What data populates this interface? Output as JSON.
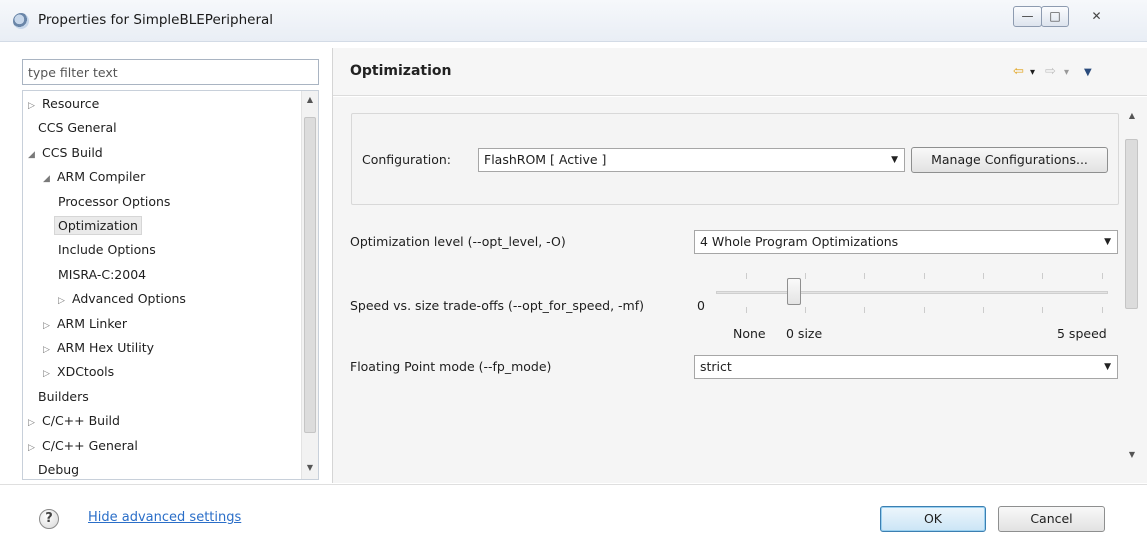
{
  "window": {
    "title": "Properties for SimpleBLEPeripheral",
    "minimize_glyph": "—",
    "maximize_glyph": "□",
    "close_glyph": "✕"
  },
  "filter": {
    "placeholder": "type filter text"
  },
  "tree": {
    "items": [
      {
        "label": "Resource",
        "arrow": "▷"
      },
      {
        "label": "CCS General",
        "arrow": ""
      },
      {
        "label": "CCS Build",
        "arrow": "◢"
      },
      {
        "label": "ARM Compiler",
        "arrow": "◢"
      },
      {
        "label": "Processor Options",
        "arrow": ""
      },
      {
        "label": "Optimization",
        "arrow": ""
      },
      {
        "label": "Include Options",
        "arrow": ""
      },
      {
        "label": "MISRA-C:2004",
        "arrow": ""
      },
      {
        "label": "Advanced Options",
        "arrow": "▷"
      },
      {
        "label": "ARM Linker",
        "arrow": "▷"
      },
      {
        "label": "ARM Hex Utility",
        "arrow": "▷"
      },
      {
        "label": "XDCtools",
        "arrow": "▷"
      },
      {
        "label": "Builders",
        "arrow": ""
      },
      {
        "label": "C/C++ Build",
        "arrow": "▷"
      },
      {
        "label": "C/C++ General",
        "arrow": "▷"
      },
      {
        "label": "Debug",
        "arrow": ""
      }
    ],
    "selected": "Optimization"
  },
  "page": {
    "title": "Optimization",
    "nav_back": "⇦",
    "nav_back_menu": "▾",
    "nav_forward": "⇨",
    "nav_forward_menu": "▾",
    "view_menu": "▼"
  },
  "config": {
    "label": "Configuration:",
    "value": "FlashROM  [ Active ]",
    "manage_button": "Manage Configurations..."
  },
  "settings": {
    "opt_level_label": "Optimization level (--opt_level, -O)",
    "opt_level_value": "4 Whole Program Optimizations",
    "speed_label": "Speed vs. size trade-offs (--opt_for_speed, -mf)",
    "speed_value": "0",
    "speed_level": 0.2,
    "speed_min": "None",
    "speed_zero": "0 size",
    "speed_max": "5 speed",
    "fp_label": "Floating Point mode (--fp_mode)",
    "fp_value": "strict"
  },
  "footer": {
    "help_glyph": "?",
    "link": "Hide advanced settings",
    "ok": "OK",
    "cancel": "Cancel"
  },
  "colors": {
    "link": "#2a6ec8",
    "ok_border": "#3c7fb1"
  }
}
